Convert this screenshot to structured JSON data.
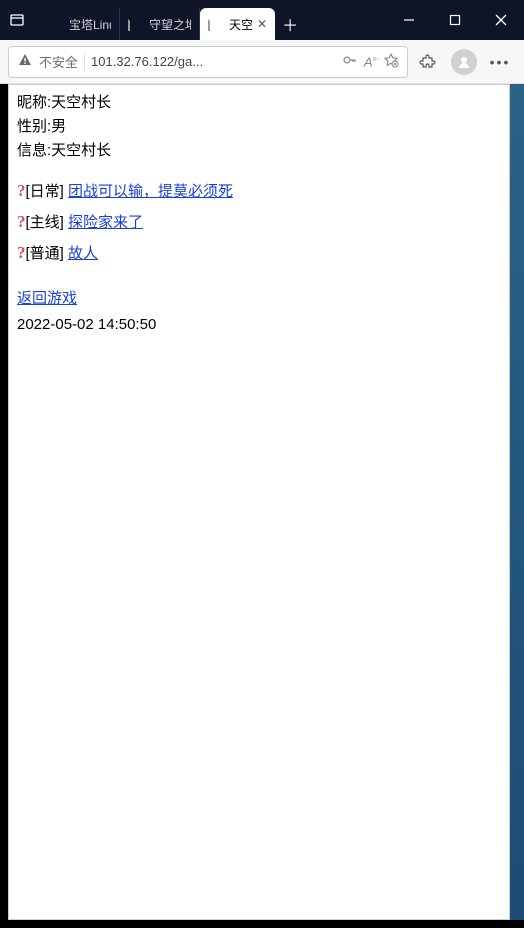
{
  "browser": {
    "tabs": [
      {
        "title": "宝塔Linu",
        "favicon": "shield-icon"
      },
      {
        "title": "守望之地",
        "favicon": "document-icon"
      },
      {
        "title": "天空",
        "favicon": "document-icon",
        "active": true
      }
    ],
    "address": {
      "not_secure_label": "不安全",
      "url": "101.32.76.122/ga..."
    }
  },
  "player": {
    "nickname_label": "昵称:",
    "nickname_value": "天空村长",
    "gender_label": "性别:",
    "gender_value": "男",
    "info_label": "信息:",
    "info_value": "天空村长"
  },
  "quests": [
    {
      "mark": "?",
      "category": "[日常]",
      "name": "团战可以输，提莫必须死"
    },
    {
      "mark": "?",
      "category": "[主线]",
      "name": "探险家来了"
    },
    {
      "mark": "?",
      "category": "[普通]",
      "name": "故人"
    }
  ],
  "footer": {
    "return_label": "返回游戏",
    "timestamp": "2022-05-02 14:50:50"
  }
}
